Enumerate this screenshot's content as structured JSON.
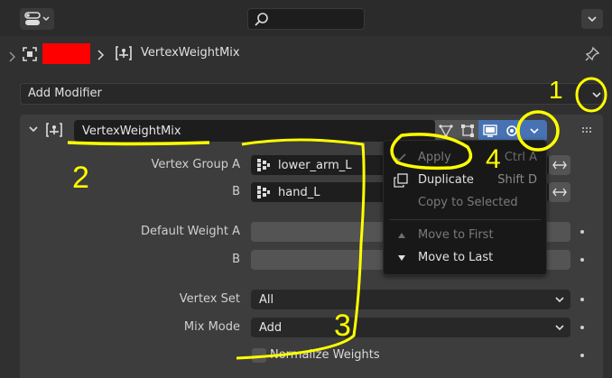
{
  "header": {
    "editor_type_icon": "properties-editor-icon",
    "search_icon": "search-icon",
    "options_icon": "chevron-down-icon"
  },
  "breadcrumb": {
    "object_icon": "object-icon",
    "object_name_color": "#ff0000",
    "modifier_icon": "vertex-weight-modifier-icon",
    "modifier_name": "VertexWeightMix",
    "pin_icon": "pin-icon"
  },
  "add_modifier": {
    "label": "Add Modifier"
  },
  "modifier": {
    "name": "VertexWeightMix",
    "fields": {
      "vertex_group_a_label": "Vertex Group A",
      "vertex_group_a_value": "lower_arm_L",
      "vertex_group_b_label": "B",
      "vertex_group_b_value": "hand_L",
      "default_weight_a_label": "Default Weight A",
      "default_weight_b_label": "B",
      "vertex_set_label": "Vertex Set",
      "vertex_set_value": "All",
      "mix_mode_label": "Mix Mode",
      "mix_mode_value": "Add",
      "normalize_label": "Normalize Weights"
    }
  },
  "context_menu": {
    "apply": "Apply",
    "apply_shortcut": "Ctrl A",
    "duplicate": "Duplicate",
    "duplicate_shortcut": "Shift D",
    "copy_to_selected": "Copy to Selected",
    "move_to_first": "Move to First",
    "move_to_last": "Move to Last"
  },
  "annotations": {
    "n1": "1",
    "n2": "2",
    "n3": "3",
    "n4": "4",
    "color": "#ffff00"
  }
}
